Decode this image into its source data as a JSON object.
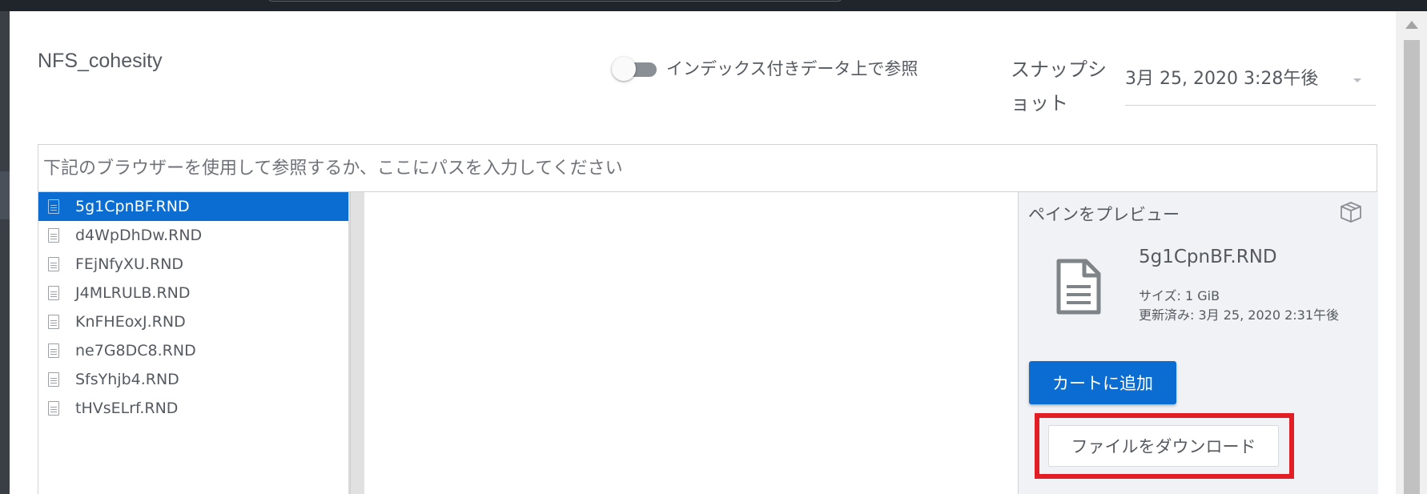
{
  "dialog": {
    "title": "NFS_cohesity",
    "indexed_toggle_label": "インデックス付きデータ上で参照",
    "snapshot_label": "スナップショット",
    "snapshot_value": "3月 25, 2020 3:28午後",
    "path_placeholder": "下記のブラウザーを使用して参照するか、ここにパスを入力してください"
  },
  "files": [
    {
      "name": "5g1CpnBF.RND"
    },
    {
      "name": "d4WpDhDw.RND"
    },
    {
      "name": "FEjNfyXU.RND"
    },
    {
      "name": "J4MLRULB.RND"
    },
    {
      "name": "KnFHEoxJ.RND"
    },
    {
      "name": "ne7G8DC8.RND"
    },
    {
      "name": "SfsYhjb4.RND"
    },
    {
      "name": "tHVsELrf.RND"
    }
  ],
  "selected_index": 0,
  "preview": {
    "title": "ペインをプレビュー",
    "file_name": "5g1CpnBF.RND",
    "size_text": "サイズ: 1 GiB",
    "modified_text": "更新済み: 3月 25, 2020 2:31午後",
    "add_to_cart_label": "カートに追加",
    "download_label": "ファイルをダウンロード"
  },
  "colors": {
    "accent": "#0b6cd1",
    "highlight": "#e31d24"
  },
  "icons": [
    "file-icon",
    "box-icon",
    "document-icon",
    "chevron-down-icon"
  ]
}
